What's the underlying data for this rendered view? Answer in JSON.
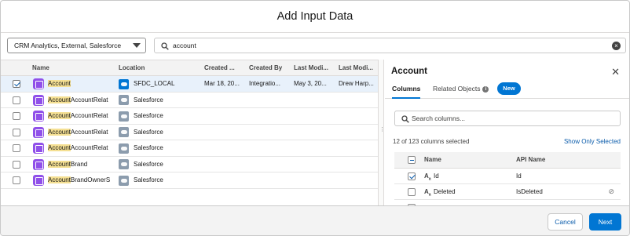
{
  "header": {
    "title": "Add Input Data"
  },
  "filters": {
    "source_selected": "CRM Analytics, External, Salesforce",
    "search_value": "account"
  },
  "table": {
    "columns": [
      "Name",
      "Location",
      "Created ...",
      "Created By",
      "Last Modi...",
      "Last Modi..."
    ],
    "rows": [
      {
        "name_match": "Account",
        "name_rest": "",
        "location": "SFDC_LOCAL",
        "location_icon": "salesforce-cloud-icon",
        "created": "Mar 18, 20...",
        "created_by": "Integratio...",
        "last_modified": "May 3, 20...",
        "last_modified_by": "Drew Harp...",
        "selected": true
      },
      {
        "name_match": "Account",
        "name_rest": "AccountRelat",
        "location": "Salesforce",
        "location_icon": "salesforce-icon",
        "created": "",
        "created_by": "",
        "last_modified": "",
        "last_modified_by": "",
        "selected": false
      },
      {
        "name_match": "Account",
        "name_rest": "AccountRelat",
        "location": "Salesforce",
        "location_icon": "salesforce-icon",
        "created": "",
        "created_by": "",
        "last_modified": "",
        "last_modified_by": "",
        "selected": false
      },
      {
        "name_match": "Account",
        "name_rest": "AccountRelat",
        "location": "Salesforce",
        "location_icon": "salesforce-icon",
        "created": "",
        "created_by": "",
        "last_modified": "",
        "last_modified_by": "",
        "selected": false
      },
      {
        "name_match": "Account",
        "name_rest": "AccountRelat",
        "location": "Salesforce",
        "location_icon": "salesforce-icon",
        "created": "",
        "created_by": "",
        "last_modified": "",
        "last_modified_by": "",
        "selected": false
      },
      {
        "name_match": "Account",
        "name_rest": "Brand",
        "location": "Salesforce",
        "location_icon": "salesforce-icon",
        "created": "",
        "created_by": "",
        "last_modified": "",
        "last_modified_by": "",
        "selected": false
      },
      {
        "name_match": "Account",
        "name_rest": "BrandOwnerS",
        "location": "Salesforce",
        "location_icon": "salesforce-icon",
        "created": "",
        "created_by": "",
        "last_modified": "",
        "last_modified_by": "",
        "selected": false
      }
    ]
  },
  "panel": {
    "title": "Account",
    "tabs": {
      "columns": "Columns",
      "related": "Related Objects",
      "new_badge": "New"
    },
    "search_placeholder": "Search columns...",
    "count_text": "12 of 123 columns selected",
    "show_selected": "Show Only Selected",
    "headers": {
      "name": "Name",
      "api": "API Name"
    },
    "rows": [
      {
        "name": "Id",
        "api": "Id",
        "checked": true,
        "type_icon": "text-type-icon"
      },
      {
        "name": "Deleted",
        "api": "IsDeleted",
        "checked": false,
        "type_icon": "text-type-icon"
      }
    ]
  },
  "footer": {
    "cancel": "Cancel",
    "next": "Next"
  },
  "colors": {
    "accent": "#0176d3",
    "dataset": "#9050e9",
    "highlight": "#f5e093",
    "selected_row": "#e8f1fb"
  }
}
